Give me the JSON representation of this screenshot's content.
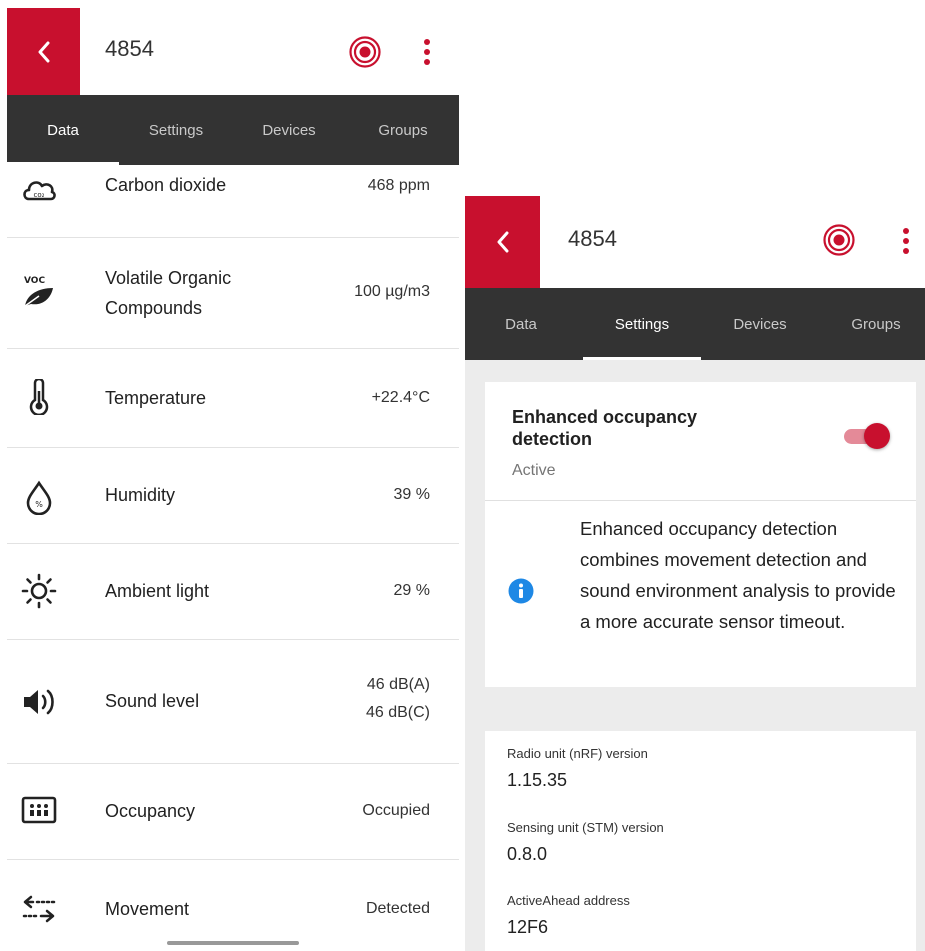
{
  "left_screen": {
    "title": "4854",
    "tabs": [
      "Data",
      "Settings",
      "Devices",
      "Groups"
    ],
    "active_tab": "Data",
    "rows": [
      {
        "icon": "cloud-co2-icon",
        "label": "Carbon dioxide",
        "value": "468 ppm"
      },
      {
        "icon": "voc-leaf-icon",
        "label": "Volatile Organic\nCompounds",
        "value": "100 µg/m3"
      },
      {
        "icon": "thermometer-icon",
        "label": "Temperature",
        "value": "+22.4°C"
      },
      {
        "icon": "humidity-drop-icon",
        "label": "Humidity",
        "value": "39 %"
      },
      {
        "icon": "sun-icon",
        "label": "Ambient light",
        "value": "29 %"
      },
      {
        "icon": "speaker-icon",
        "label": "Sound level",
        "value": "46 dB(A)\n46 dB(C)"
      },
      {
        "icon": "occupancy-grid-icon",
        "label": "Occupancy",
        "value": "Occupied"
      },
      {
        "icon": "movement-arrows-icon",
        "label": "Movement",
        "value": "Detected"
      }
    ]
  },
  "right_screen": {
    "title": "4854",
    "tabs": [
      "Data",
      "Settings",
      "Devices",
      "Groups"
    ],
    "active_tab": "Settings",
    "setting": {
      "title": "Enhanced occupancy\ndetection",
      "status": "Active",
      "enabled": true,
      "info": "Enhanced occupancy detection combines movement detection and sound environment analysis to provide a more accurate sensor timeout."
    },
    "versions": [
      {
        "label": "Radio unit (nRF) version",
        "value": "1.15.35"
      },
      {
        "label": "Sensing unit (STM) version",
        "value": "0.8.0"
      },
      {
        "label": "ActiveAhead address",
        "value": "12F6"
      }
    ]
  },
  "colors": {
    "accent": "#c8102e",
    "tab_bar": "#333333",
    "info_blue": "#1e88e5"
  }
}
